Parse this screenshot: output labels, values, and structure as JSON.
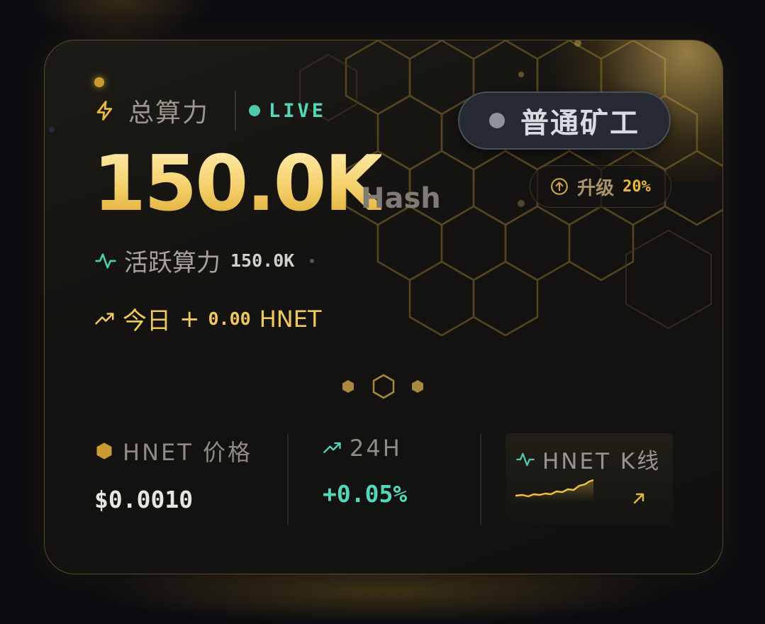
{
  "hashrate": {
    "title": "总算力",
    "live": "LIVE",
    "value": "150.0K",
    "unit": "Hash"
  },
  "miner_badge": {
    "label": "普通矿工"
  },
  "upgrade": {
    "label": "升级",
    "percent": "20%"
  },
  "active": {
    "label": "活跃算力",
    "value": "150.0K"
  },
  "today": {
    "label": "今日",
    "sign": "+",
    "value": "0.00",
    "unit": "HNET"
  },
  "stats": {
    "price_label": "HNET 价格",
    "price_value": "$0.0010",
    "change_label": "24H",
    "change_value": "+0.05%",
    "kline_label": "HNET K线"
  },
  "colors": {
    "gold": "#f0c95a",
    "teal": "#54d8bb",
    "muted": "#8f8c86"
  }
}
